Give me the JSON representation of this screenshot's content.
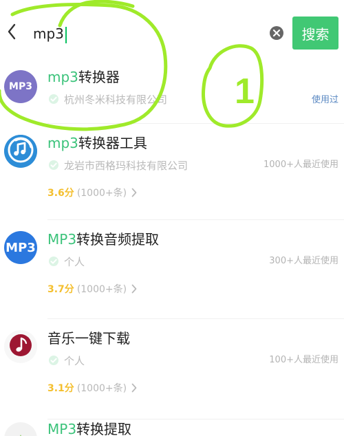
{
  "search": {
    "query": "mp3",
    "button_label": "搜索"
  },
  "results": [
    {
      "title_hl": "mp3",
      "title_rest": "转换器",
      "logo_text": "MP3",
      "developer": "杭州冬米科技有限公司",
      "meta": "使用过",
      "score": "",
      "reviews": ""
    },
    {
      "title_hl": "mp3",
      "title_rest": "转换器工具",
      "logo_text": "",
      "developer": "龙岩市西格玛科技有限公司",
      "meta": "1000+人最近使用",
      "score": "3.6分",
      "reviews": "(1000+条)"
    },
    {
      "title_hl": "MP3",
      "title_rest": "转换音频提取",
      "logo_text": "MP3",
      "developer": "个人",
      "meta": "300+人最近使用",
      "score": "3.7分",
      "reviews": "(1000+条)"
    },
    {
      "title_hl": "",
      "title_rest": "音乐一键下载",
      "logo_text": "",
      "developer": "个人",
      "meta": "100+人最近使用",
      "score": "3.1分",
      "reviews": "(1000+条)"
    },
    {
      "title_hl": "MP3",
      "title_rest": "转换提取",
      "logo_text": "",
      "developer": "",
      "meta": "",
      "score": "",
      "reviews": ""
    }
  ],
  "annotation": {
    "mark": "1"
  },
  "icons": {
    "back": "chevron-left-icon",
    "clear": "clear-icon",
    "verified": "verified-check-icon",
    "chevron": "chevron-right-icon"
  },
  "colors": {
    "accent": "#41c874",
    "highlight": "#3cc37b",
    "score": "#f4bf2e",
    "muted": "#b9b9b9",
    "badge": "#5a88c2",
    "annotation": "#9fea2a"
  }
}
